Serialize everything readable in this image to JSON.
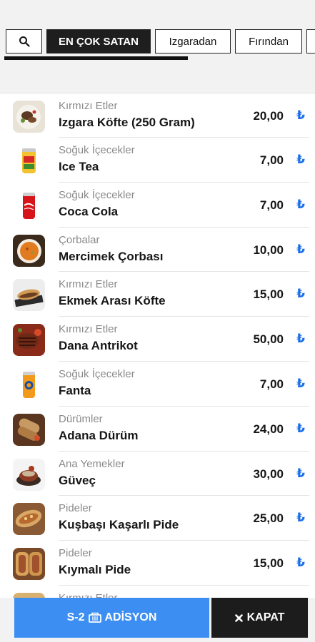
{
  "tabs": {
    "search_icon": "search-icon",
    "items": [
      {
        "label": "EN ÇOK SATAN",
        "active": true
      },
      {
        "label": "Izgaradan",
        "active": false
      },
      {
        "label": "Fırından",
        "active": false
      },
      {
        "label": "",
        "active": false
      }
    ]
  },
  "currency_symbol": "₺",
  "colors": {
    "accent_blue": "#3d8ef2",
    "currency_blue": "#1a6fe8",
    "dark": "#1c1c1c"
  },
  "products": [
    {
      "category": "Kırmızı Etler",
      "name": "Izgara Köfte (250 Gram)",
      "price": "20,00",
      "icon": "kofte-plate-image"
    },
    {
      "category": "Soğuk İçecekler",
      "name": "Ice Tea",
      "price": "7,00",
      "icon": "ice-tea-can-image"
    },
    {
      "category": "Soğuk İçecekler",
      "name": "Coca Cola",
      "price": "7,00",
      "icon": "coca-cola-can-image"
    },
    {
      "category": "Çorbalar",
      "name": "Mercimek Çorbası",
      "price": "10,00",
      "icon": "lentil-soup-image"
    },
    {
      "category": "Kırmızı Etler",
      "name": "Ekmek Arası Köfte",
      "price": "15,00",
      "icon": "kofte-sandwich-image"
    },
    {
      "category": "Kırmızı Etler",
      "name": "Dana Antrikot",
      "price": "50,00",
      "icon": "steak-image"
    },
    {
      "category": "Soğuk İçecekler",
      "name": "Fanta",
      "price": "7,00",
      "icon": "fanta-can-image"
    },
    {
      "category": "Dürümler",
      "name": "Adana Dürüm",
      "price": "24,00",
      "icon": "durum-wrap-image"
    },
    {
      "category": "Ana Yemekler",
      "name": "Güveç",
      "price": "30,00",
      "icon": "guvec-image"
    },
    {
      "category": "Pideler",
      "name": "Kuşbaşı Kaşarlı Pide",
      "price": "25,00",
      "icon": "pide-image"
    },
    {
      "category": "Pideler",
      "name": "Kıymalı Pide",
      "price": "15,00",
      "icon": "kiymali-pide-image"
    }
  ],
  "partial_item": {
    "category": "Kırmızı Etler"
  },
  "bottom": {
    "adisyon_table": "S-2",
    "adisyon_label": "ADİSYON",
    "kapat_label": "KAPAT"
  }
}
